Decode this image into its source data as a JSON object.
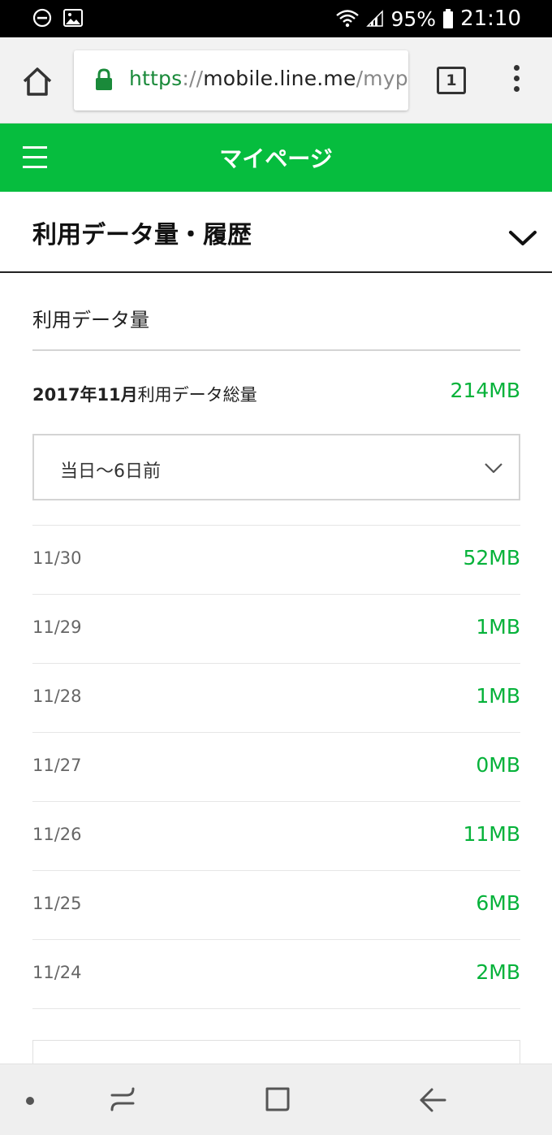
{
  "status_bar": {
    "battery": "95%",
    "time": "21:10"
  },
  "browser": {
    "url_scheme": "https",
    "url_sep": "://",
    "url_host": "mobile.line.me",
    "url_path": "/myp",
    "tab_count": "1"
  },
  "header": {
    "title": "マイページ"
  },
  "section": {
    "title": "利用データ量・履歴",
    "subtitle": "利用データ量"
  },
  "total": {
    "month": "2017年11月",
    "label": "利用データ総量",
    "value": "214MB"
  },
  "range_select": {
    "selected": "当日〜6日前"
  },
  "usage_rows": [
    {
      "date": "11/30",
      "value": "52MB"
    },
    {
      "date": "11/29",
      "value": "1MB"
    },
    {
      "date": "11/28",
      "value": "1MB"
    },
    {
      "date": "11/27",
      "value": "0MB"
    },
    {
      "date": "11/26",
      "value": "11MB"
    },
    {
      "date": "11/25",
      "value": "6MB"
    },
    {
      "date": "11/24",
      "value": "2MB"
    }
  ],
  "colors": {
    "brand_green": "#06bd3e",
    "value_green": "#06b23a"
  },
  "icons": {
    "status_left": [
      "do-not-disturb-icon",
      "image-icon"
    ],
    "status_right": [
      "wifi-icon",
      "signal-icon",
      "battery-icon"
    ],
    "browser": [
      "home-icon",
      "lock-icon",
      "tabs-icon",
      "overflow-menu-icon"
    ],
    "nav": [
      "recent-apps-icon",
      "home-nav-icon",
      "back-icon"
    ]
  }
}
